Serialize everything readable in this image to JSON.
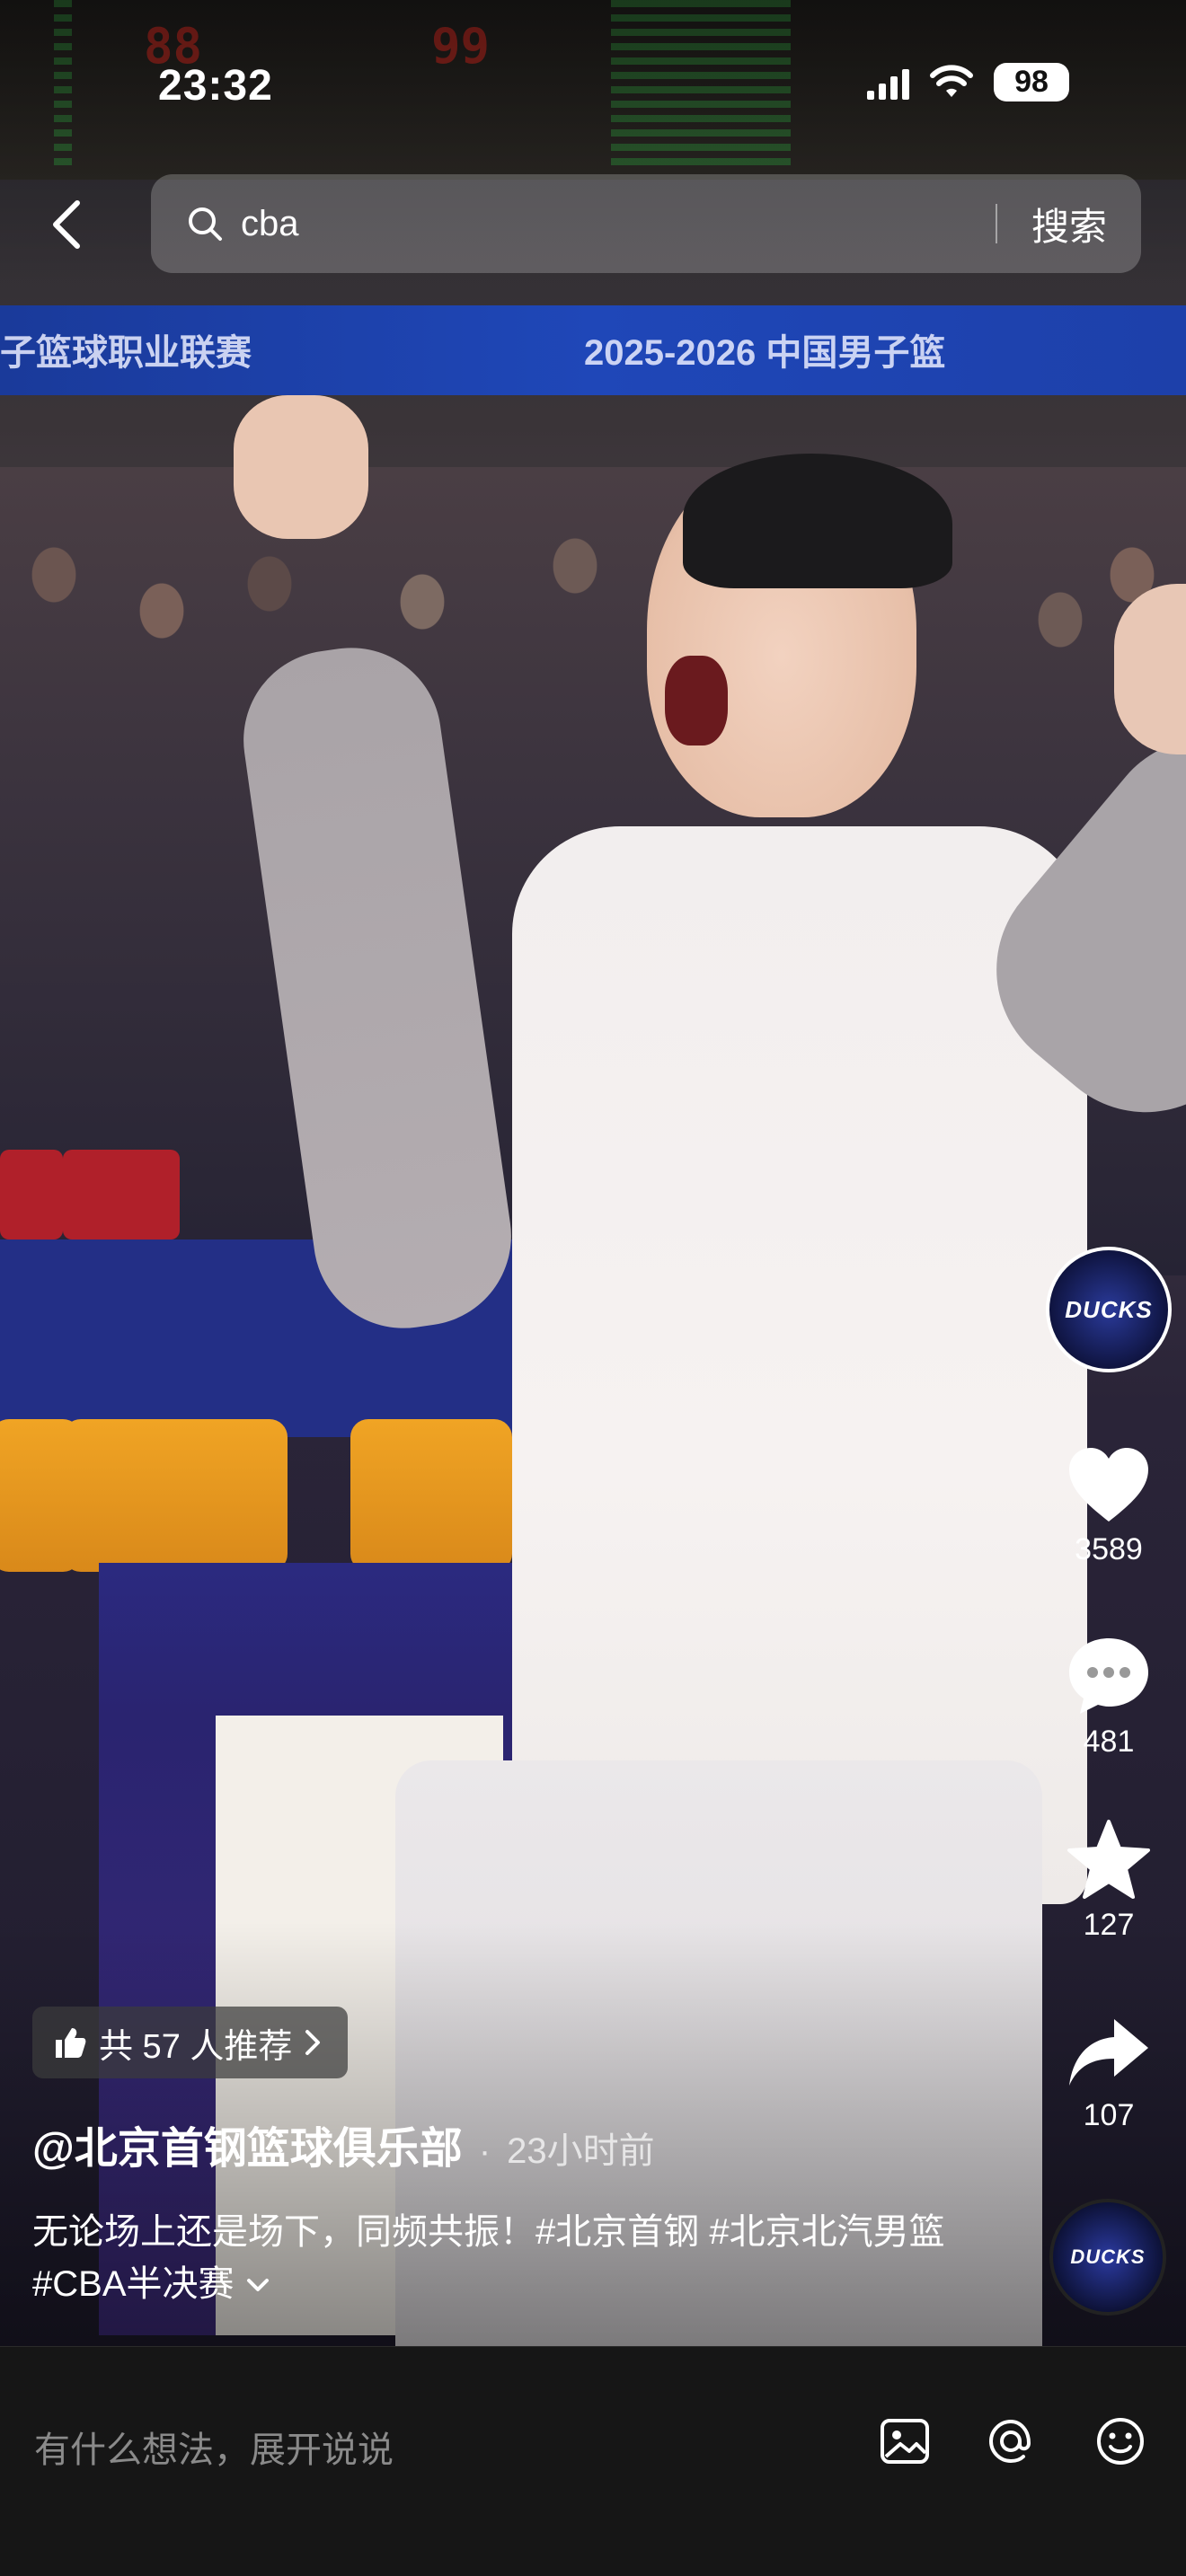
{
  "status_bar": {
    "time": "23:32",
    "battery": "98"
  },
  "search": {
    "query": "cba",
    "button_label": "搜索"
  },
  "video_overlay": {
    "score_left": "88",
    "score_right": "99",
    "banner_left": "子篮球职业联赛",
    "banner_right": "2025-2026 中国男子篮"
  },
  "rail": {
    "avatar_text": "DUCKS",
    "likes": "3589",
    "comments": "481",
    "favorites": "127",
    "shares": "107"
  },
  "caption": {
    "recommend": "共 57 人推荐",
    "author": "@北京首钢篮球俱乐部",
    "separator": "·",
    "time_ago": "23小时前",
    "description": "无论场上还是场下，同频共振！#北京首钢 #北京北汽男篮 #CBA半决赛"
  },
  "comment_bar": {
    "placeholder": "有什么想法，展开说说"
  },
  "icons": [
    "back-icon",
    "search-icon",
    "heart-icon",
    "comment-icon",
    "star-icon",
    "share-icon",
    "thumbs-up-icon",
    "image-icon",
    "at-icon",
    "emoji-icon"
  ]
}
